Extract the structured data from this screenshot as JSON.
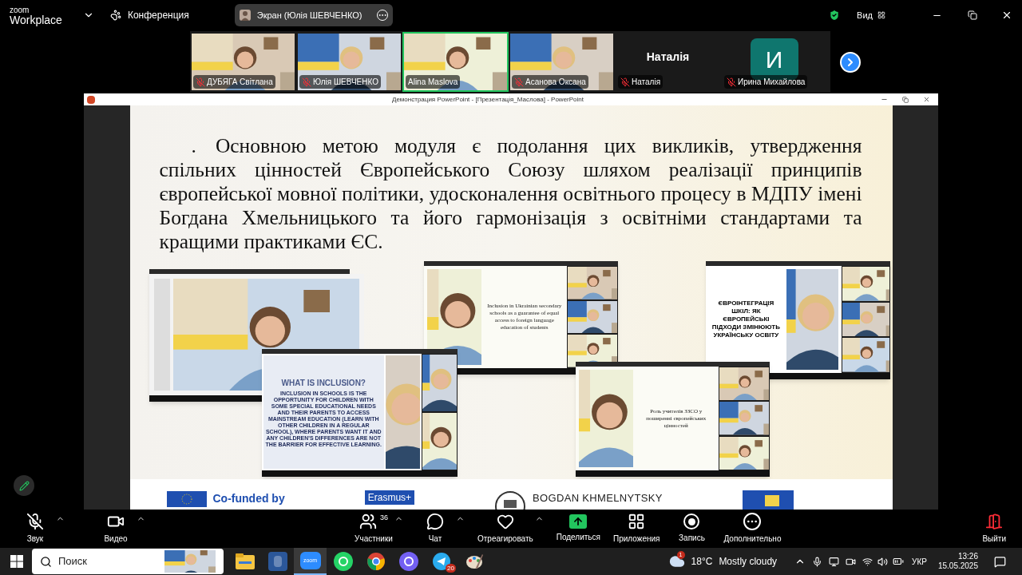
{
  "topbar": {
    "logo_line1": "zoom",
    "logo_line2": "Workplace",
    "meeting": "Конференция",
    "share_pill": "Экран (Юлія ШЕВЧЕНКО)",
    "view": "Вид"
  },
  "participants": [
    {
      "name": "ДУБЯГА Світлана",
      "kind": "video",
      "muted": true,
      "speaking": false
    },
    {
      "name": "Юлія ШЕВЧЕНКО",
      "kind": "video",
      "muted": true,
      "speaking": false
    },
    {
      "name": "Alina Maslova",
      "kind": "video",
      "muted": false,
      "speaking": true
    },
    {
      "name": "Асанова Оксана",
      "kind": "video",
      "muted": true,
      "speaking": false
    },
    {
      "name": "Наталія",
      "kind": "name",
      "big_name": "Наталія",
      "muted": true,
      "speaking": false
    },
    {
      "name": "Ирина Михайлова",
      "kind": "avatar",
      "initial": "И",
      "muted": true,
      "speaking": false
    }
  ],
  "share_window": {
    "title": "Демонстрация PowerPoint - [Презентація_Маслова] - PowerPoint"
  },
  "slide": {
    "bullet": ".",
    "paragraph": "Основною метою модуля є подолання цих викликів, утвердження спільних цінностей Європейського Союзу шляхом реалізації принципів європейської мовної політики, удосконалення освітнього процесу в МДПУ імені Богдана Хмельницького та його гармонізація з освітніми стандартами та кращими практиками ЄС.",
    "screenshots": [
      {
        "kind": "slide"
      },
      {
        "kind": "title",
        "title": "Inclusion in Ukrainian secondary schools as a guarantee of equal access to foreign language education of students"
      },
      {
        "kind": "banner",
        "title": "ЄВРОІНТЕГРАЦІЯ ШКІЛ: ЯК ЄВРОПЕЙСЬКІ ПІДХОДИ ЗМІНЮЮТЬ УКРАЇНСЬКУ ОСВІТУ"
      },
      {
        "kind": "poster",
        "title": "WHAT IS INCLUSION?",
        "body": "INCLUSION IN SCHOOLS IS THE OPPORTUNITY FOR CHILDREN WITH SOME SPECIAL EDUCATIONAL NEEDS AND THEIR PARENTS TO ACCESS MAINSTREAM EDUCATION (LEARN WITH OTHER CHILDREN IN A REGULAR SCHOOL), WHERE PARENTS WANT IT AND ANY CHILDREN'S DIFFERENCES ARE NOT THE BARRIER FOR EFFECTIVE LEARNING."
      },
      {
        "kind": "title",
        "title": "Роль учителів ЗЗСО у поширенні європейських цінностей"
      }
    ],
    "footer": [
      {
        "kind": "eu",
        "text": "Co-funded by"
      },
      {
        "kind": "erasmus",
        "text": "Erasmus+"
      },
      {
        "kind": "university",
        "text": "BOGDAN KHMELNYTSKY"
      },
      {
        "kind": "flag"
      }
    ]
  },
  "toolbar": [
    {
      "label": "Звук",
      "kind": "mic",
      "muted": true,
      "caret": true
    },
    {
      "label": "Видео",
      "kind": "video",
      "muted": false,
      "caret": true
    },
    {
      "label": "Участники",
      "kind": "participants",
      "count": "36",
      "caret": true
    },
    {
      "label": "Чат",
      "kind": "chat",
      "caret": true
    },
    {
      "label": "Отреагировать",
      "kind": "react",
      "caret": true
    },
    {
      "label": "Поделиться",
      "kind": "share",
      "caret": false
    },
    {
      "label": "Приложения",
      "kind": "apps",
      "caret": false
    },
    {
      "label": "Запись",
      "kind": "record",
      "caret": false
    },
    {
      "label": "Дополнительно",
      "kind": "more",
      "caret": false
    }
  ],
  "leave": {
    "label": "Выйти"
  },
  "taskbar": {
    "search_placeholder": "Поиск",
    "apps": [
      {
        "kind": "folder",
        "active": false
      },
      {
        "kind": "word",
        "active": false
      },
      {
        "kind": "zoom",
        "active": true,
        "label": "zoom"
      },
      {
        "kind": "whatsapp",
        "active": false
      },
      {
        "kind": "chrome",
        "active": false
      },
      {
        "kind": "viber",
        "active": false
      },
      {
        "kind": "telegram",
        "active": false,
        "badge": "20"
      },
      {
        "kind": "paint",
        "active": false
      }
    ],
    "weather_badge": "1",
    "temperature": "18°C",
    "weather": "Mostly cloudy",
    "language": "УКР",
    "time": "13:26",
    "date": "15.05.2025"
  }
}
